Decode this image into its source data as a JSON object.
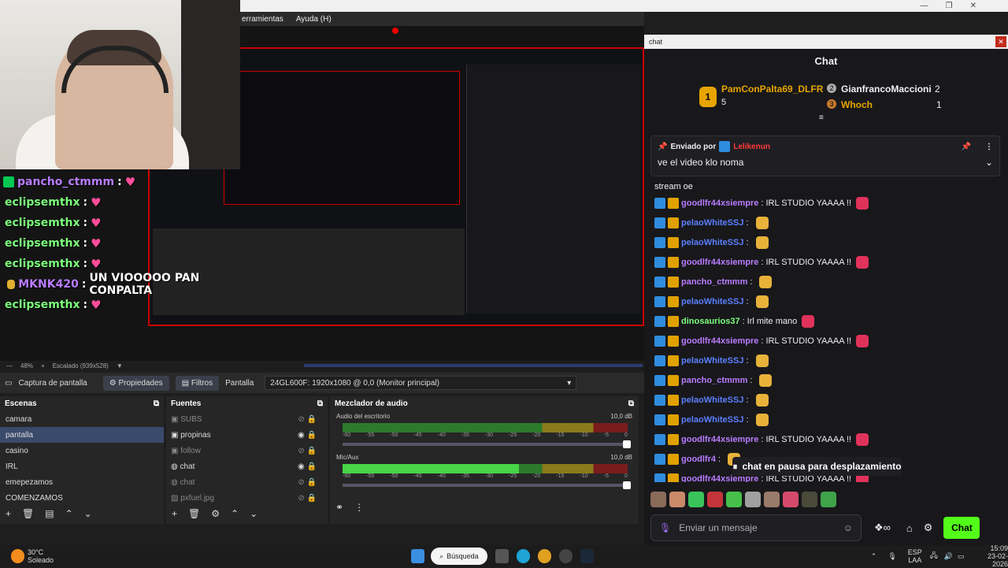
{
  "window_controls": [
    "—",
    "❐",
    "✕"
  ],
  "obs": {
    "menu": [
      "erramientas",
      "Ayuda (H)"
    ],
    "scale": {
      "zoom": "48%",
      "label": "Escalado (939x528)"
    },
    "props_bar": {
      "source": "Captura de pantalla",
      "properties": "Propiedades",
      "filters": "Filtros",
      "display_label": "Pantalla",
      "display_value": "24GL600F: 1920x1080 @ 0,0 (Monitor principal)"
    },
    "scenes": {
      "title": "Escenas",
      "items": [
        "camara",
        "pantalla",
        "casino",
        "IRL",
        "emepezamos",
        "COMENZAMOS"
      ],
      "selected": 1
    },
    "sources": {
      "title": "Fuentes",
      "items": [
        {
          "name": "SUBS",
          "visible": false
        },
        {
          "name": "propinas",
          "visible": true
        },
        {
          "name": "follow",
          "visible": false
        },
        {
          "name": "chat",
          "visible": true
        },
        {
          "name": "chat",
          "visible": false
        },
        {
          "name": "pxfuel.jpg",
          "visible": false
        }
      ]
    },
    "mixer": {
      "title": "Mezclador de audio",
      "scale": [
        "-60",
        "-55",
        "-50",
        "-45",
        "-40",
        "-35",
        "-30",
        "-25",
        "-20",
        "-15",
        "-10",
        "-5",
        "0"
      ],
      "channels": [
        {
          "name": "Audio del escritorio",
          "db": "10,0 dB",
          "level": 0.0
        },
        {
          "name": "Mic/Aux",
          "db": "10,0 dB",
          "level": 0.62
        }
      ]
    }
  },
  "stream_overlay": {
    "lines": [
      {
        "user": "pancho_ctmmm",
        "text": ""
      },
      {
        "user": "eclipsemthx",
        "text": ""
      },
      {
        "user": "eclipsemthx",
        "text": ""
      },
      {
        "user": "eclipsemthx",
        "text": ""
      },
      {
        "user": "eclipsemthx",
        "text": ""
      },
      {
        "user": "MKNK420",
        "text": "UN VIOOOOO PAN CONPALTA"
      },
      {
        "user": "eclipsemthx",
        "text": ""
      }
    ]
  },
  "chat": {
    "window_title": "chat",
    "title": "Chat",
    "leaderboard": [
      {
        "rank": "1",
        "user": "PamConPalta69_DLFR",
        "count": "5"
      },
      {
        "rank": "2",
        "user": "GianfrancoMaccioni",
        "count": "2"
      },
      {
        "rank": "3",
        "user": "Whoch",
        "count": "1"
      }
    ],
    "pinned": {
      "by_label": "Enviado por",
      "by_user": "Lelikenun",
      "text": "ve el video klo noma"
    },
    "top_fragment": "stream oe",
    "messages": [
      {
        "user": "goodlfr44xsiempre",
        "text": "IRL STUDIO YAAAA !!",
        "color": "#b97cff"
      },
      {
        "user": "pelaoWhiteSSJ",
        "text": "",
        "color": "#5b7fff"
      },
      {
        "user": "pelaoWhiteSSJ",
        "text": "",
        "color": "#5b7fff"
      },
      {
        "user": "goodlfr44xsiempre",
        "text": "IRL STUDIO YAAAA !!",
        "color": "#b97cff"
      },
      {
        "user": "pancho_ctmmm",
        "text": "",
        "color": "#b97cff"
      },
      {
        "user": "pelaoWhiteSSJ",
        "text": "",
        "color": "#5b7fff"
      },
      {
        "user": "dinosaurios37",
        "text": "Irl mite mano",
        "color": "#7dff7d"
      },
      {
        "user": "goodlfr44xsiempre",
        "text": "IRL STUDIO YAAAA !!",
        "color": "#b97cff"
      },
      {
        "user": "pelaoWhiteSSJ",
        "text": "",
        "color": "#5b7fff"
      },
      {
        "user": "pancho_ctmmm",
        "text": "",
        "color": "#b97cff"
      },
      {
        "user": "pelaoWhiteSSJ",
        "text": "",
        "color": "#5b7fff"
      },
      {
        "user": "pelaoWhiteSSJ",
        "text": "",
        "color": "#5b7fff"
      },
      {
        "user": "goodlfr44xsiempre",
        "text": "IRL STUDIO YAAAA !!",
        "color": "#b97cff"
      },
      {
        "user": "goodlfr4",
        "text": "",
        "color": "#b97cff"
      },
      {
        "user": "goodlfr44xsiempre",
        "text": "IRL STUDIO YAAAA !!",
        "color": "#b97cff"
      }
    ],
    "paused": "chat en pausa para desplazamiento",
    "input_placeholder": "Enviar un mensaje",
    "send": "Chat"
  },
  "taskbar": {
    "weather_temp": "30°C",
    "weather_desc": "Soleado",
    "search": "Búsqueda",
    "lang": "ESP",
    "lang2": "LAA",
    "time": "15:09",
    "date": "23-02-2026"
  }
}
